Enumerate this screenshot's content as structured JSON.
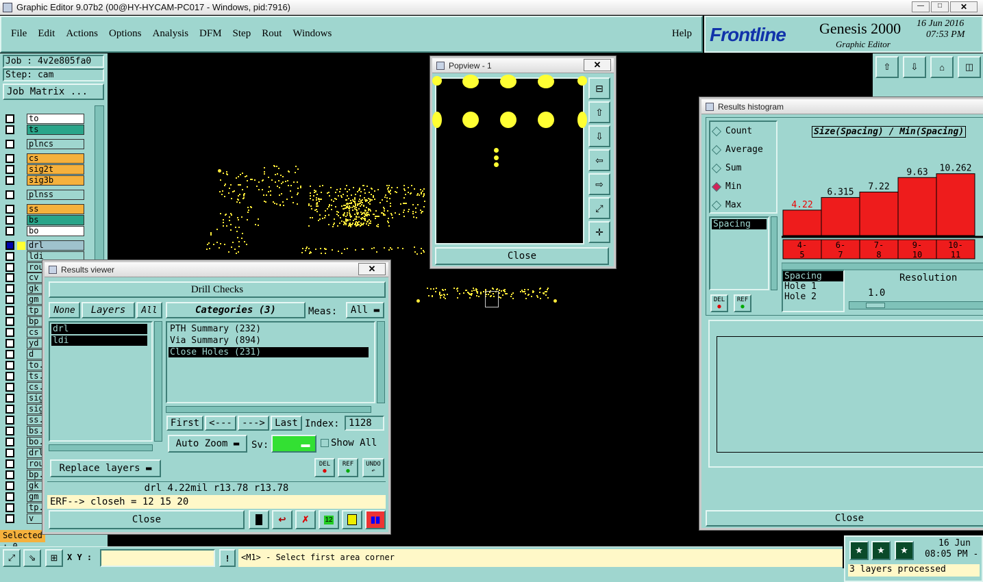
{
  "window_title": "Graphic Editor 9.07b2 (00@HY-HYCAM-PC017 - Windows, pid:7916)",
  "menu": [
    "File",
    "Edit",
    "Actions",
    "Options",
    "Analysis",
    "DFM",
    "Step",
    "Rout",
    "Windows"
  ],
  "help": "Help",
  "brand": {
    "logo": "Frontline",
    "product": "Genesis 2000",
    "subtitle": "Graphic Editor",
    "date": "16 Jun 2016",
    "time": "07:53 PM"
  },
  "job": {
    "job": "Job : 4v2e805fa0",
    "step": "Step: cam",
    "matrix": "Job Matrix ..."
  },
  "layers": [
    {
      "name": "to",
      "color": "#ffffff"
    },
    {
      "name": "ts",
      "color": "#2aa58a"
    },
    {
      "name": "plncs",
      "color": "#9fd6cf"
    },
    {
      "name": "cs",
      "color": "#f5b13d"
    },
    {
      "name": "sig2t",
      "color": "#f5b13d"
    },
    {
      "name": "sig3b",
      "color": "#f5b13d"
    },
    {
      "name": "plnss",
      "color": "#9fd6cf"
    },
    {
      "name": "ss",
      "color": "#f5b13d"
    },
    {
      "name": "bs",
      "color": "#2aa58a"
    },
    {
      "name": "bo",
      "color": "#ffffff"
    },
    {
      "name": "drl",
      "color": "#9fc2cc"
    },
    {
      "name": "ldi",
      "color": "#9fd6cf"
    },
    {
      "name": "rou",
      "color": "#9fd6cf"
    }
  ],
  "layers2": [
    "cv",
    "gk",
    "gm",
    "tp",
    "bp",
    "cs",
    "yd",
    "d",
    "to.",
    "ts.",
    "cs.",
    "sig",
    "sig",
    "ss.",
    "bs.",
    "bo.",
    "drl",
    "rou",
    "bp.",
    "gk",
    "gm",
    "tp.",
    "v"
  ],
  "selected": "Selected : 0",
  "popview": {
    "title": "Popview - 1",
    "close": "Close"
  },
  "results_viewer": {
    "title": "Results viewer",
    "header": "Drill Checks",
    "none": "None",
    "layers_label": "Layers",
    "all": "All",
    "categories": "Categories (3)",
    "meas_label": "Meas:",
    "meas_value": "All",
    "layer_items": [
      "drl",
      "ldi"
    ],
    "category_items": [
      "PTH Summary (232)",
      "Via Summary (894)",
      "Close Holes (231)"
    ],
    "first": "First",
    "prev": "<---",
    "next": "--->",
    "last": "Last",
    "index_label": "Index:",
    "index_value": "1128",
    "auto_zoom": "Auto Zoom",
    "sv_label": "Sv:",
    "show_all": "Show All",
    "replace": "Replace layers",
    "del": "DEL",
    "ref": "REF",
    "undo": "UNDO",
    "info": "drl 4.22mil   r13.78   r13.78",
    "erf": "ERF--> closeh = 12 15 20",
    "close": "Close"
  },
  "histogram": {
    "title": "Results histogram",
    "options": [
      "Count",
      "Average",
      "Sum",
      "Min",
      "Max"
    ],
    "selected": "Min",
    "measure": "Spacing",
    "chart_title": "Size(Spacing) / Min(Spacing)",
    "del": "DEL",
    "ref": "REF",
    "spacing": "Spacing",
    "hole1": "Hole 1",
    "hole2": "Hole 2",
    "resolution_label": "Resolution",
    "resolution_value": "1.0",
    "close": "Close"
  },
  "chart_data": {
    "type": "bar",
    "title": "Size(Spacing) / Min(Spacing)",
    "categories": [
      "4-5",
      "6-7",
      "7-8",
      "9-10",
      "10-11"
    ],
    "values": [
      4.22,
      6.315,
      7.22,
      9.63,
      10.262
    ]
  },
  "status": {
    "xy_label": "X Y :",
    "xy_value": "",
    "message": "<M1> - Select first area corner",
    "date": "16 Jun",
    "time": "08:05 PM -",
    "processed": "3 layers processed"
  }
}
